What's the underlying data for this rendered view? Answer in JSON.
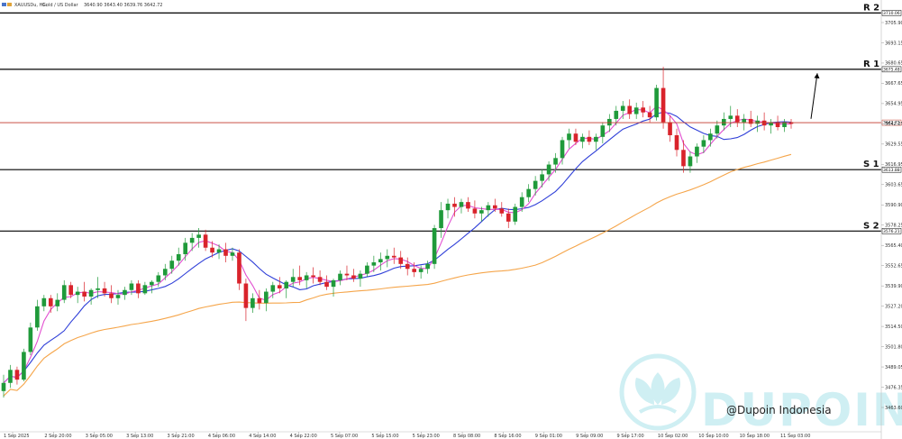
{
  "header": {
    "symbol": "XAUUSDu, H1:",
    "description": "Gold / US Dollar",
    "ohlc": "3640.90 3643.40 3639.76 3642.72"
  },
  "watermark": {
    "brand": "DUPOIN",
    "handle": "@Dupoin Indonesia"
  },
  "colors": {
    "bull": "#1f9a3a",
    "bear": "#d9232b",
    "ma_fast": "#e24fd0",
    "ma_mid": "#2f3fd8",
    "ma_slow": "#f5a54a",
    "price_line": "#c0392b",
    "level_line": "#000000",
    "logo": "#cfeff3"
  },
  "chart_data": {
    "type": "candlestick",
    "symbol": "XAUUSDu",
    "timeframe": "H1",
    "ylim": [
      3453,
      3718
    ],
    "y_ticks": [
      "3705.90",
      "3693.15",
      "3680.65",
      "3667.65",
      "3654.95",
      "3642.25",
      "3629.55",
      "3616.95",
      "3603.65",
      "3590.90",
      "3578.25",
      "3565.40",
      "3552.65",
      "3539.90",
      "3527.20",
      "3514.50",
      "3501.80",
      "3489.05",
      "3476.35",
      "3463.60"
    ],
    "x_labels": [
      "1 Sep 2025",
      "2 Sep 20:00",
      "3 Sep 05:00",
      "3 Sep 13:00",
      "3 Sep 21:00",
      "4 Sep 06:00",
      "4 Sep 14:00",
      "4 Sep 22:00",
      "5 Sep 07:00",
      "5 Sep 15:00",
      "5 Sep 23:00",
      "8 Sep 08:00",
      "8 Sep 16:00",
      "9 Sep 01:00",
      "9 Sep 09:00",
      "9 Sep 17:00",
      "10 Sep 02:00",
      "10 Sep 10:00",
      "10 Sep 18:00",
      "11 Sep 03:00"
    ],
    "levels": [
      {
        "name": "R 2",
        "price": 3710.06,
        "tag": "3710.06"
      },
      {
        "name": "R 1",
        "price": 3675.48,
        "tag": "3675.48"
      },
      {
        "name": "S 1",
        "price": 3613.88,
        "tag": "3613.88"
      },
      {
        "name": "S 2",
        "price": 3576.21,
        "tag": "3576.21"
      }
    ],
    "current_price": {
      "price": 3642.72,
      "tag": "3642.72"
    },
    "forecast_arrow": {
      "from_price": 3644,
      "to_price": 3673,
      "direction": "up"
    },
    "candles_ohlc": [
      [
        3478,
        3488,
        3474,
        3483
      ],
      [
        3483,
        3494,
        3480,
        3491
      ],
      [
        3491,
        3493,
        3482,
        3485
      ],
      [
        3485,
        3504,
        3484,
        3502
      ],
      [
        3502,
        3520,
        3500,
        3517
      ],
      [
        3517,
        3534,
        3515,
        3530
      ],
      [
        3530,
        3537,
        3527,
        3535
      ],
      [
        3535,
        3537,
        3526,
        3530
      ],
      [
        3530,
        3538,
        3527,
        3534
      ],
      [
        3534,
        3546,
        3532,
        3543
      ],
      [
        3543,
        3545,
        3535,
        3537
      ],
      [
        3537,
        3542,
        3532,
        3539
      ],
      [
        3539,
        3545,
        3533,
        3536
      ],
      [
        3536,
        3541,
        3531,
        3540
      ],
      [
        3540,
        3548,
        3535,
        3541
      ],
      [
        3541,
        3545,
        3536,
        3538
      ],
      [
        3538,
        3543,
        3532,
        3535
      ],
      [
        3535,
        3540,
        3531,
        3537
      ],
      [
        3537,
        3542,
        3534,
        3540
      ],
      [
        3540,
        3546,
        3537,
        3544
      ],
      [
        3544,
        3546,
        3535,
        3538
      ],
      [
        3538,
        3545,
        3537,
        3543
      ],
      [
        3543,
        3546,
        3538,
        3545
      ],
      [
        3545,
        3551,
        3542,
        3549
      ],
      [
        3549,
        3556,
        3546,
        3553
      ],
      [
        3553,
        3561,
        3550,
        3558
      ],
      [
        3558,
        3566,
        3555,
        3562
      ],
      [
        3562,
        3572,
        3558,
        3569
      ],
      [
        3569,
        3575,
        3564,
        3572
      ],
      [
        3572,
        3578,
        3566,
        3574
      ],
      [
        3574,
        3577,
        3564,
        3566
      ],
      [
        3566,
        3570,
        3560,
        3563
      ],
      [
        3563,
        3568,
        3559,
        3565
      ],
      [
        3565,
        3569,
        3557,
        3561
      ],
      [
        3561,
        3566,
        3558,
        3563
      ],
      [
        3563,
        3565,
        3540,
        3544
      ],
      [
        3544,
        3547,
        3521,
        3529
      ],
      [
        3529,
        3538,
        3526,
        3535
      ],
      [
        3535,
        3540,
        3528,
        3532
      ],
      [
        3532,
        3541,
        3527,
        3539
      ],
      [
        3539,
        3545,
        3535,
        3543
      ],
      [
        3543,
        3548,
        3538,
        3541
      ],
      [
        3541,
        3546,
        3535,
        3545
      ],
      [
        3545,
        3553,
        3542,
        3548
      ],
      [
        3548,
        3555,
        3543,
        3546
      ],
      [
        3546,
        3551,
        3541,
        3549
      ],
      [
        3549,
        3554,
        3544,
        3548
      ],
      [
        3548,
        3552,
        3543,
        3545
      ],
      [
        3545,
        3549,
        3540,
        3542
      ],
      [
        3542,
        3547,
        3536,
        3546
      ],
      [
        3546,
        3552,
        3543,
        3550
      ],
      [
        3550,
        3555,
        3546,
        3549
      ],
      [
        3549,
        3553,
        3545,
        3547
      ],
      [
        3547,
        3552,
        3542,
        3550
      ],
      [
        3550,
        3557,
        3548,
        3555
      ],
      [
        3555,
        3561,
        3551,
        3557
      ],
      [
        3557,
        3563,
        3552,
        3559
      ],
      [
        3559,
        3565,
        3554,
        3561
      ],
      [
        3561,
        3566,
        3556,
        3560
      ],
      [
        3560,
        3564,
        3553,
        3556
      ],
      [
        3556,
        3560,
        3549,
        3553
      ],
      [
        3553,
        3557,
        3548,
        3551
      ],
      [
        3551,
        3555,
        3547,
        3553
      ],
      [
        3553,
        3558,
        3550,
        3556
      ],
      [
        3556,
        3580,
        3553,
        3578
      ],
      [
        3578,
        3594,
        3572,
        3589
      ],
      [
        3589,
        3596,
        3584,
        3593
      ],
      [
        3593,
        3597,
        3585,
        3591
      ],
      [
        3591,
        3596,
        3587,
        3594
      ],
      [
        3594,
        3597,
        3588,
        3590
      ],
      [
        3590,
        3595,
        3584,
        3587
      ],
      [
        3587,
        3591,
        3582,
        3589
      ],
      [
        3589,
        3594,
        3585,
        3592
      ],
      [
        3592,
        3596,
        3588,
        3590
      ],
      [
        3590,
        3594,
        3585,
        3587
      ],
      [
        3587,
        3590,
        3578,
        3582
      ],
      [
        3582,
        3593,
        3580,
        3591
      ],
      [
        3591,
        3600,
        3588,
        3597
      ],
      [
        3597,
        3605,
        3594,
        3602
      ],
      [
        3602,
        3610,
        3598,
        3607
      ],
      [
        3607,
        3614,
        3603,
        3611
      ],
      [
        3611,
        3619,
        3607,
        3617
      ],
      [
        3617,
        3624,
        3612,
        3621
      ],
      [
        3621,
        3634,
        3617,
        3632
      ],
      [
        3632,
        3639,
        3627,
        3636
      ],
      [
        3636,
        3639,
        3629,
        3631
      ],
      [
        3631,
        3636,
        3627,
        3634
      ],
      [
        3634,
        3638,
        3629,
        3631
      ],
      [
        3631,
        3636,
        3626,
        3634
      ],
      [
        3634,
        3643,
        3630,
        3641
      ],
      [
        3641,
        3648,
        3637,
        3645
      ],
      [
        3645,
        3653,
        3641,
        3650
      ],
      [
        3650,
        3656,
        3645,
        3653
      ],
      [
        3653,
        3657,
        3645,
        3648
      ],
      [
        3648,
        3655,
        3645,
        3652
      ],
      [
        3652,
        3656,
        3646,
        3649
      ],
      [
        3649,
        3653,
        3643,
        3646
      ],
      [
        3646,
        3666,
        3644,
        3664
      ],
      [
        3664,
        3677,
        3639,
        3643
      ],
      [
        3643,
        3647,
        3631,
        3635
      ],
      [
        3635,
        3639,
        3622,
        3626
      ],
      [
        3626,
        3632,
        3612,
        3616
      ],
      [
        3616,
        3625,
        3612,
        3622
      ],
      [
        3622,
        3630,
        3618,
        3628
      ],
      [
        3628,
        3635,
        3624,
        3632
      ],
      [
        3632,
        3639,
        3628,
        3636
      ],
      [
        3636,
        3644,
        3633,
        3641
      ],
      [
        3641,
        3649,
        3638,
        3645
      ],
      [
        3645,
        3653,
        3640,
        3647
      ],
      [
        3647,
        3651,
        3640,
        3643
      ],
      [
        3643,
        3648,
        3638,
        3645
      ],
      [
        3645,
        3650,
        3640,
        3642
      ],
      [
        3642,
        3647,
        3637,
        3644
      ],
      [
        3644,
        3649,
        3638,
        3641
      ],
      [
        3641,
        3645,
        3636,
        3643
      ],
      [
        3643,
        3647,
        3638,
        3640
      ],
      [
        3640,
        3645,
        3637,
        3643
      ],
      [
        3643,
        3645,
        3639,
        3642
      ]
    ]
  }
}
